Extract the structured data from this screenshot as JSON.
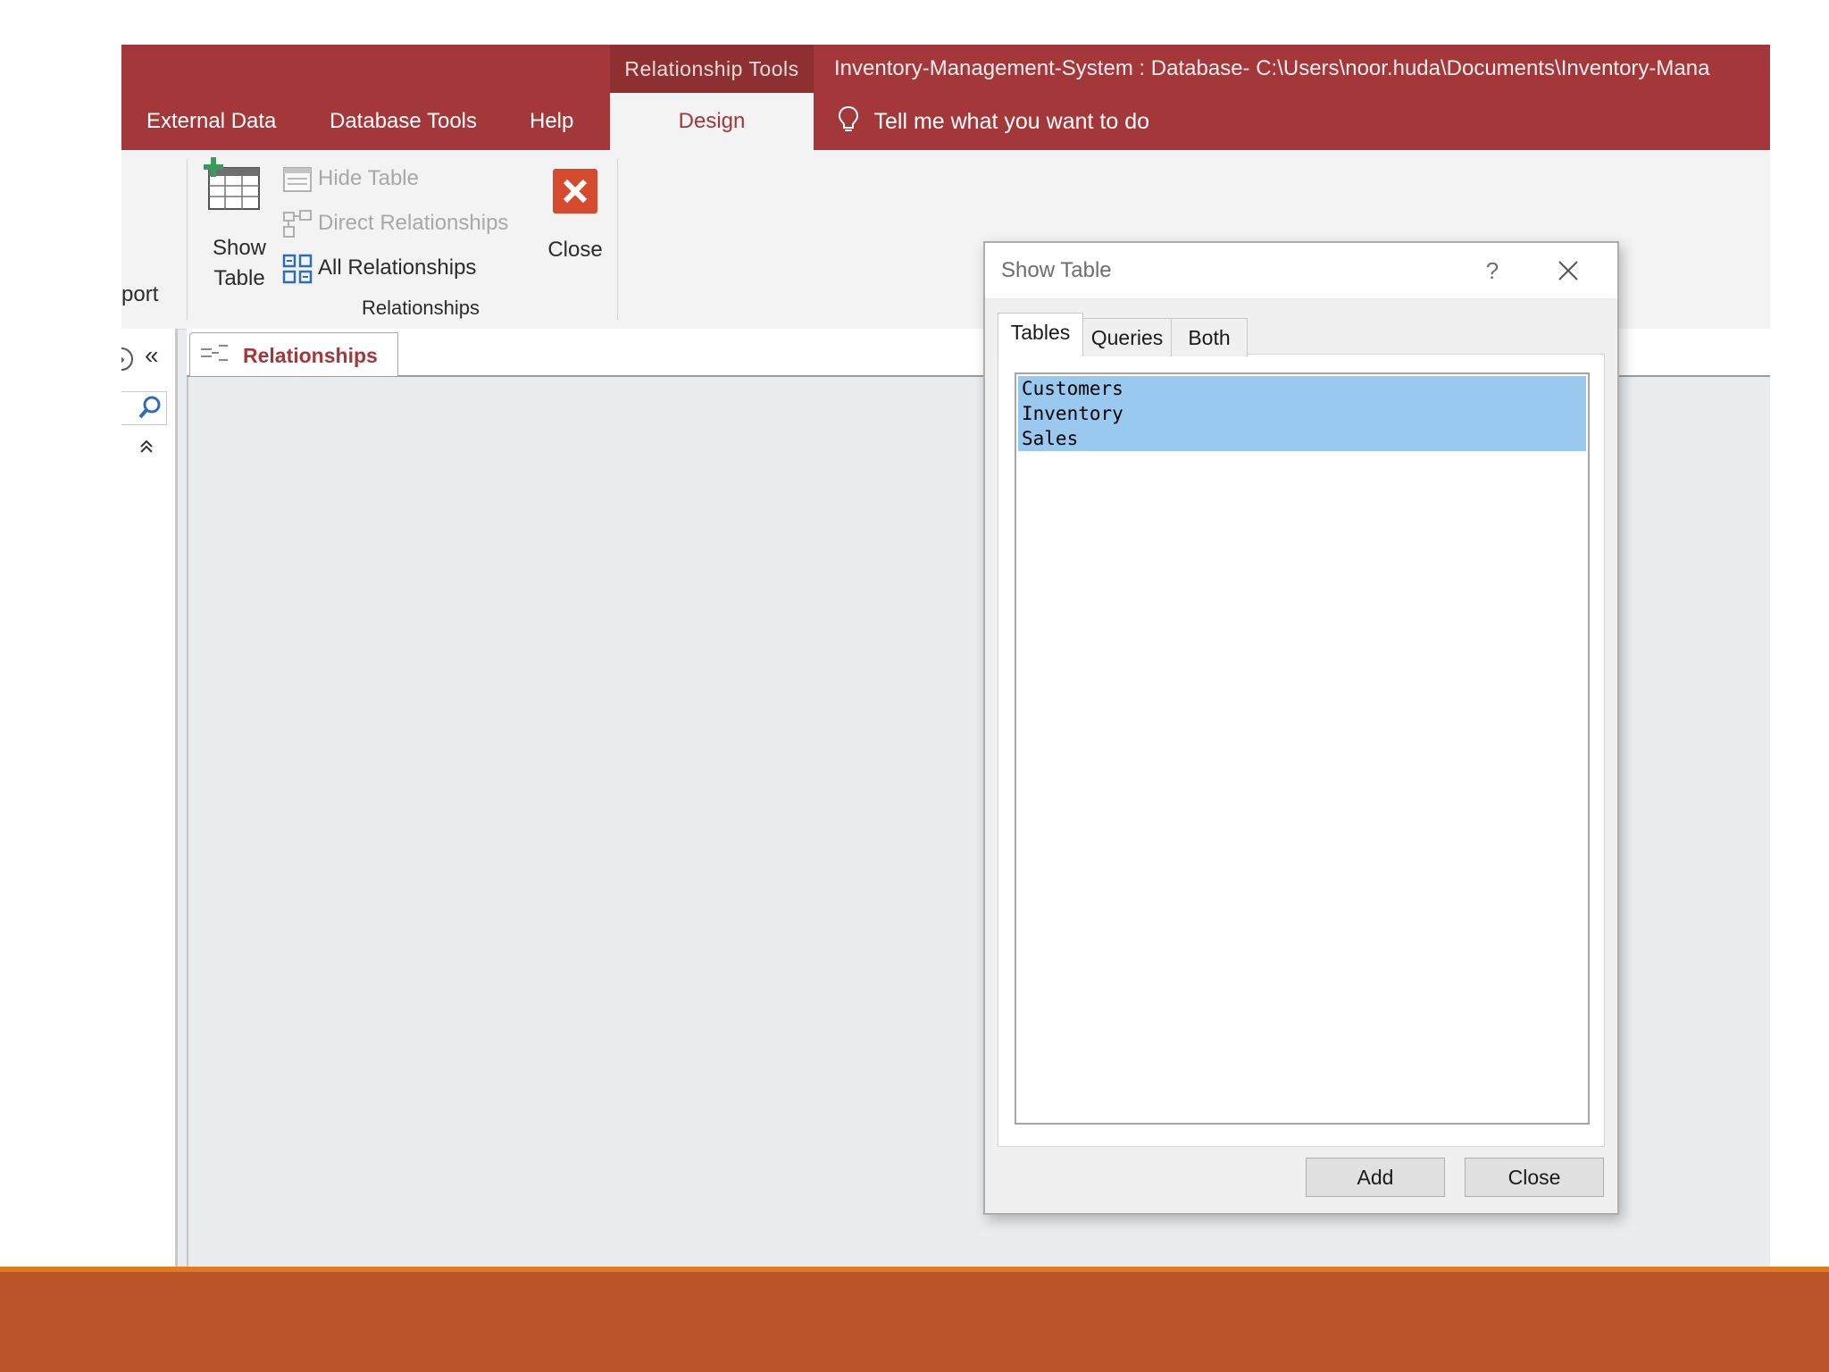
{
  "title_bar": {
    "context_label": "Relationship Tools",
    "document_title": "Inventory-Management-System : Database- C:\\Users\\noor.huda\\Documents\\Inventory-Mana"
  },
  "ribbon_tabs": {
    "external_data": "External Data",
    "database_tools": "Database Tools",
    "help": "Help",
    "design": "Design",
    "tell_me": "Tell me what you want to do"
  },
  "ribbon": {
    "partial_label": "port",
    "show_table_line1": "Show",
    "show_table_line2": "Table",
    "hide_table": "Hide Table",
    "direct_relationships": "Direct Relationships",
    "all_relationships": "All Relationships",
    "close": "Close",
    "group_label": "Relationships"
  },
  "nav": {
    "collapse_glyph": "«",
    "expand_glyph": "⌃"
  },
  "document_tab": {
    "label": "Relationships"
  },
  "dialog": {
    "title": "Show Table",
    "help": "?",
    "tabs": [
      "Tables",
      "Queries",
      "Both"
    ],
    "items": [
      "Customers",
      "Inventory",
      "Sales"
    ],
    "add_button": "Add",
    "close_button": "Close"
  },
  "colors": {
    "accent": "#a4373a",
    "selection": "#99c9ee",
    "deco_bar": "#bc542a",
    "deco_line": "#e07b22"
  }
}
